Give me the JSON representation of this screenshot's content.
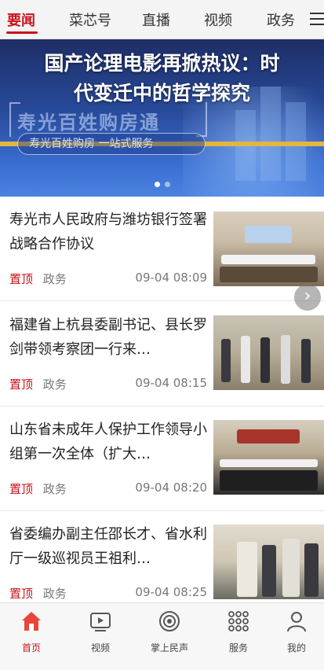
{
  "top_nav": {
    "tabs": [
      {
        "label": "要闻",
        "active": true
      },
      {
        "label": "菜芯号",
        "active": false
      },
      {
        "label": "直播",
        "active": false
      },
      {
        "label": "视频",
        "active": false
      },
      {
        "label": "政务",
        "active": false
      }
    ],
    "menu_icon": "hamburger-menu-icon"
  },
  "banner": {
    "headline_line1": "国产论理电影再掀热议：时",
    "headline_line2": "代变迁中的哲学探究",
    "bg_title": "寿光百姓购房通",
    "pill_text": "寿光百姓购房 一站式服务",
    "slide_count": 2,
    "active_slide": 0
  },
  "news": [
    {
      "title": "寿光市人民政府与潍坊银行签署战略合作协议",
      "tag": "置顶",
      "category": "政务",
      "time": "09-04 08:09"
    },
    {
      "title": "福建省上杭县委副书记、县长罗剑带领考察团一行来…",
      "tag": "置顶",
      "category": "政务",
      "time": "09-04 08:15"
    },
    {
      "title": "山东省未成年人保护工作领导小组第一次全体（扩大…",
      "tag": "置顶",
      "category": "政务",
      "time": "09-04 08:20"
    },
    {
      "title": "省委编办副主任邵长才、省水利厅一级巡视员王祖利…",
      "tag": "置顶",
      "category": "政务",
      "time": "09-04 08:25"
    }
  ],
  "bottom_nav": [
    {
      "label": "首页",
      "icon": "home-icon",
      "active": true
    },
    {
      "label": "视频",
      "icon": "video-play-icon",
      "active": false
    },
    {
      "label": "掌上民声",
      "icon": "voice-target-icon",
      "active": false
    },
    {
      "label": "服务",
      "icon": "grid-dots-icon",
      "active": false
    },
    {
      "label": "我的",
      "icon": "user-icon",
      "active": false
    }
  ],
  "colors": {
    "accent": "#c8141c",
    "gold": "#e2b640"
  }
}
